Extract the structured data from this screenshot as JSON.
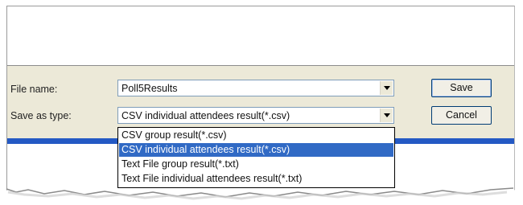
{
  "dialog": {
    "file_name_label": "File name:",
    "file_name_value": "Poll5Results",
    "save_as_type_label": "Save as type:",
    "save_as_type_value": "CSV individual attendees result(*.csv)",
    "save_button": "Save",
    "cancel_button": "Cancel"
  },
  "type_dropdown": {
    "options": [
      "CSV group result(*.csv)",
      "CSV individual attendees result(*.csv)",
      "Text File group result(*.txt)",
      "Text File individual attendees result(*.txt)"
    ],
    "selected_index": 1
  },
  "colors": {
    "dialog_bg": "#ece9d8",
    "selection": "#316ac5",
    "accent_strip": "#2459c4"
  },
  "icons": {
    "dropdown_arrow": "chevron-down-icon"
  }
}
